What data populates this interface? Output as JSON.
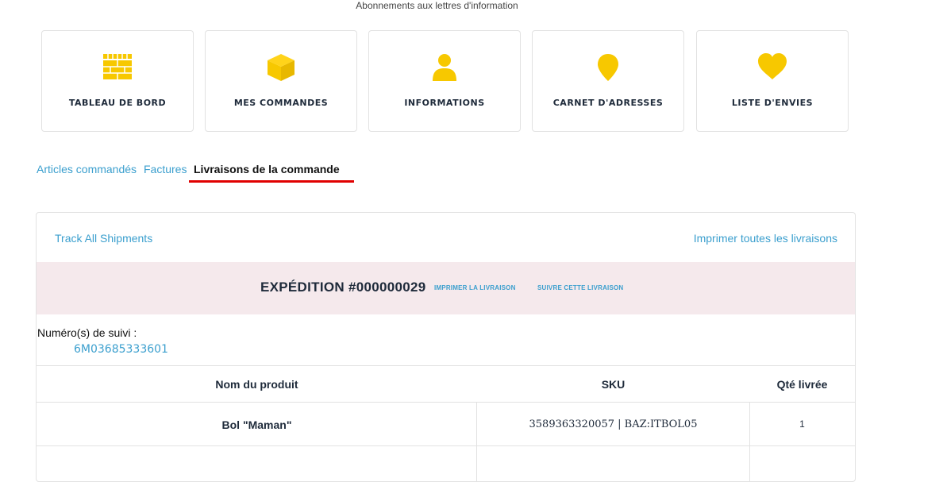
{
  "header": {
    "newsletter_link": "Abonnements aux lettres d'information"
  },
  "cards": [
    {
      "label": "TABLEAU DE BORD",
      "icon": "dashboard-icon"
    },
    {
      "label": "MES COMMANDES",
      "icon": "box-icon"
    },
    {
      "label": "INFORMATIONS",
      "icon": "user-icon"
    },
    {
      "label": "CARNET D'ADRESSES",
      "icon": "location-pin-icon"
    },
    {
      "label": "LISTE D'ENVIES",
      "icon": "heart-icon"
    }
  ],
  "tabs": [
    {
      "label": "Articles commandés",
      "active": false
    },
    {
      "label": "Factures",
      "active": false
    },
    {
      "label": "Livraisons de la commande",
      "active": true
    }
  ],
  "shipments": {
    "track_all": "Track All Shipments",
    "print_all": "Imprimer toutes les livraisons",
    "shipment_title": "EXPÉDITION #000000029",
    "print_shipment": "IMPRIMER LA LIVRAISON",
    "track_shipment": "SUIVRE CETTE LIVRAISON",
    "tracking_label": "Numéro(s) de suivi :",
    "tracking_number": "6M03685333601",
    "columns": [
      "Nom du produit",
      "SKU",
      "Qté livrée"
    ],
    "rows": [
      {
        "product": "Bol \"Maman\"",
        "sku": "3589363320057 | BAZ:ITBOL05",
        "qty": "1"
      }
    ]
  },
  "colors": {
    "accent_yellow": "#f7c800",
    "link_blue": "#3b9fce",
    "active_underline": "#e00000",
    "shipment_band": "#f5e9ec"
  }
}
